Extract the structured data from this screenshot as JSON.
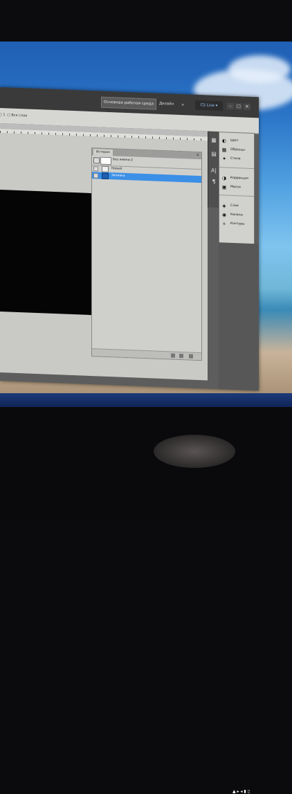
{
  "app": {
    "workspace_button": "Основная рабочая среда",
    "design_label": "Дизайн",
    "more_glyph": "»",
    "cslive_label": "CS Live ▾",
    "win_buttons": [
      "–",
      "□",
      "✕"
    ]
  },
  "options_bar": {
    "check1": "▢ 1",
    "check2": "▢ Все слои"
  },
  "history_panel": {
    "tab_label": "История",
    "menu_glyph": "≡",
    "snapshot_label": "Без имени-2",
    "rows": [
      {
        "label": "Новый"
      },
      {
        "label": "Заливка",
        "selected": true
      }
    ]
  },
  "right_panels": {
    "group1": [
      {
        "icon": "◐",
        "label": "Цвет"
      },
      {
        "icon": "▦",
        "label": "Образцы"
      },
      {
        "icon": "✦",
        "label": "Стили"
      }
    ],
    "group2": [
      {
        "icon": "◑",
        "label": "Коррекция"
      },
      {
        "icon": "▣",
        "label": "Маски"
      }
    ],
    "group3": [
      {
        "icon": "◈",
        "label": "Слои"
      },
      {
        "icon": "◉",
        "label": "Каналы"
      },
      {
        "icon": "⌗",
        "label": "Контуры"
      }
    ]
  },
  "icon_strip": [
    "▦",
    "▤",
    "A|",
    "¶"
  ],
  "taskbar": {
    "tray": "▲ ▸ ◂ ▮ ▯"
  },
  "colors": {
    "selection": "#3b8fe6",
    "panel_bg": "#cfcfcc",
    "window_dark": "#3a3a3a"
  }
}
